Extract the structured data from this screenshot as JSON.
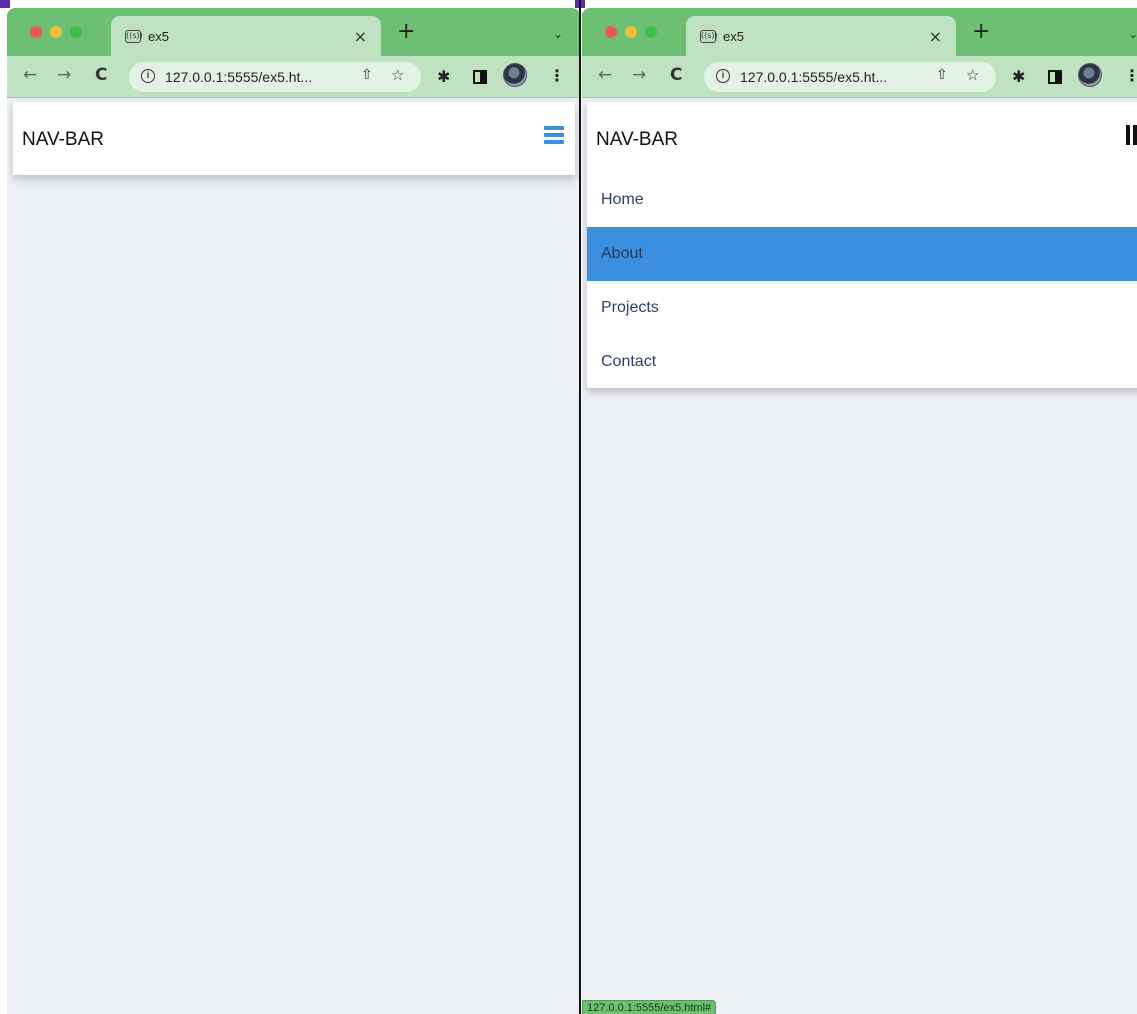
{
  "browser_left": {
    "tab_title": "ex5",
    "favicon_glyph": "((s))",
    "tab_close": "×",
    "new_tab": "+",
    "tab_menu": "⌄",
    "url": "127.0.0.1:5555/ex5.ht...",
    "back": "←",
    "forward": "→",
    "reload": "C",
    "share": "⇧",
    "bookmark": "☆",
    "extensions": "✱",
    "menu": "⋮"
  },
  "browser_right": {
    "tab_title": "ex5",
    "favicon_glyph": "((s))",
    "tab_close": "×",
    "new_tab": "+",
    "tab_menu": "⌄",
    "url": "127.0.0.1:5555/ex5.ht...",
    "back": "←",
    "forward": "→",
    "reload": "C",
    "share": "⇧",
    "bookmark": "☆",
    "extensions": "✱",
    "menu": "⋮",
    "status_url": "127.0.0.1:5555/ex5.html#"
  },
  "page_left": {
    "brand": "NAV-BAR",
    "toggle_icon": "hamburger-icon"
  },
  "page_right": {
    "brand": "NAV-BAR",
    "toggle_icon": "vertical-bars-icon",
    "menu": [
      {
        "label": "Home",
        "active": false
      },
      {
        "label": "About",
        "active": true
      },
      {
        "label": "Projects",
        "active": false
      },
      {
        "label": "Contact",
        "active": false
      }
    ]
  },
  "colors": {
    "tab_strip": "#6dbf73",
    "toolbar": "#bfe3c1",
    "accent": "#3a8fde",
    "page_bg": "#edf0f5",
    "link": "#2f3e6b"
  }
}
